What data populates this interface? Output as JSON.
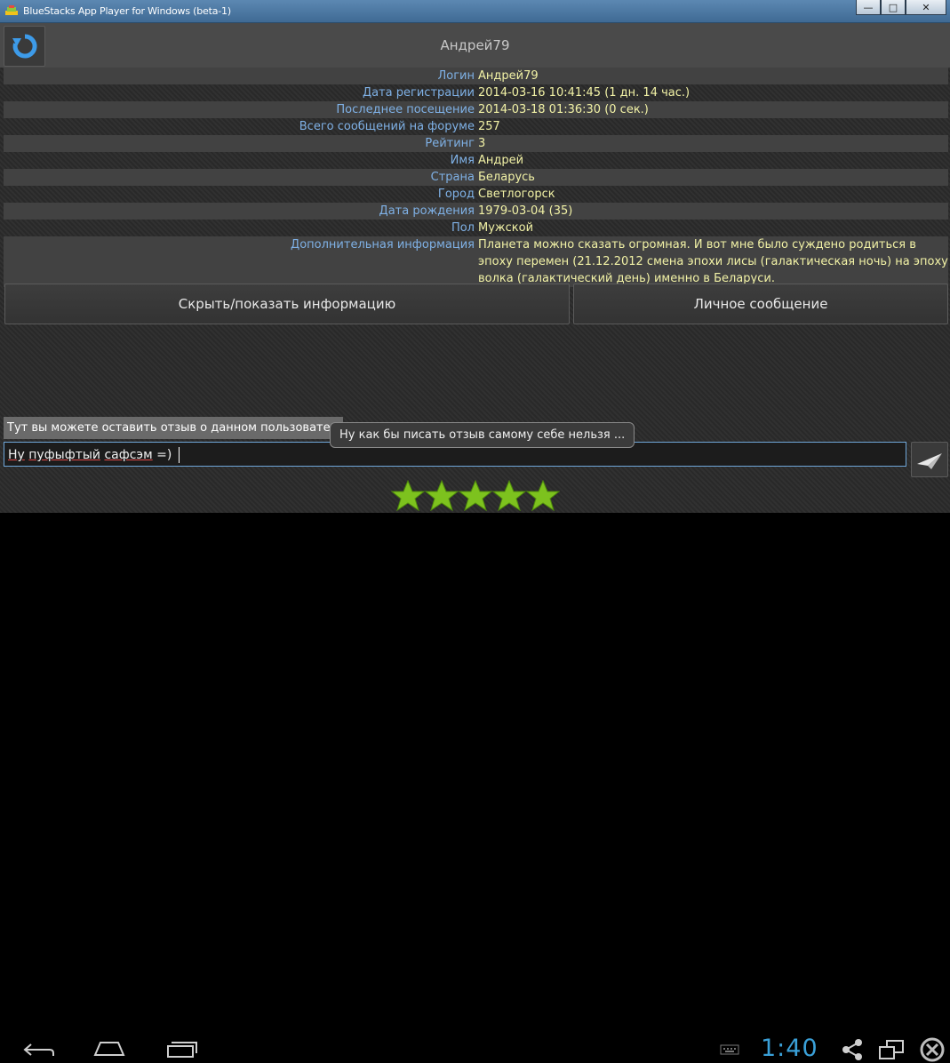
{
  "window": {
    "title": "BlueStacks App Player for Windows (beta-1)",
    "min": "—",
    "max": "□",
    "close": "✕"
  },
  "header": {
    "title": "Андрей79",
    "refresh_icon": "refresh-icon"
  },
  "profile": [
    {
      "label": "Логин",
      "value": "Андрей79"
    },
    {
      "label": "Дата регистрации",
      "value": "2014-03-16 10:41:45 (1 дн. 14 час.)"
    },
    {
      "label": "Последнее посещение",
      "value": "2014-03-18 01:36:30 (0 сек.)"
    },
    {
      "label": "Всего сообщений на форуме",
      "value": "257"
    },
    {
      "label": "Рейтинг",
      "value": "3"
    },
    {
      "label": "Имя",
      "value": "Андрей"
    },
    {
      "label": "Страна",
      "value": "Беларусь"
    },
    {
      "label": "Город",
      "value": "Светлогорск"
    },
    {
      "label": "Дата рождения",
      "value": "1979-03-04 (35)"
    },
    {
      "label": "Пол",
      "value": "Мужской"
    },
    {
      "label": "Дополнительная информация",
      "value": "Планета можно сказать огромная. И вот мне было суждено родиться в эпоху перемен (21.12.2012 смена эпохи лисы (галактическая ночь) на эпоху волка (галактический день) именно в Беларуси."
    }
  ],
  "buttons": {
    "toggle_info": "Скрыть/показать информацию",
    "private_message": "Личное сообщение"
  },
  "review": {
    "hint": "Тут вы можете оставить отзыв о данном пользователе",
    "toast": "Ну как бы писать отзыв самому себе нельзя ...",
    "input_words": [
      "Ну",
      "пуфыфтый",
      "сафсэм",
      "=)"
    ],
    "stars": 5,
    "star_color": "#7dc21e"
  },
  "status": {
    "clock": "1:40",
    "clock_color": "#3aa0d8"
  }
}
